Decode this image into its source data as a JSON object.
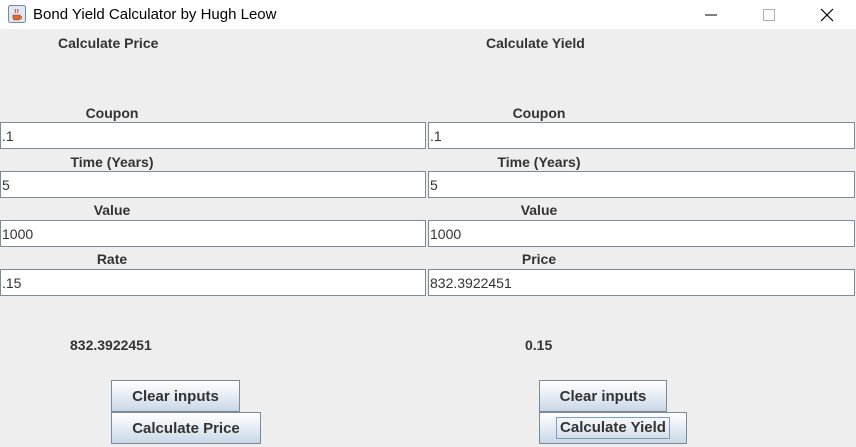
{
  "window": {
    "title": "Bond Yield Calculator by Hugh Leow"
  },
  "price_panel": {
    "title": "Calculate Price",
    "coupon_label": "Coupon",
    "coupon_value": ".1",
    "time_label": "Time (Years)",
    "time_value": "5",
    "value_label": "Value",
    "value_value": "1000",
    "rate_label": "Rate",
    "rate_value": ".15",
    "result": "832.3922451",
    "clear_label": "Clear inputs",
    "calculate_label": "Calculate Price"
  },
  "yield_panel": {
    "title": "Calculate Yield",
    "coupon_label": "Coupon",
    "coupon_value": ".1",
    "time_label": "Time (Years)",
    "time_value": "5",
    "value_label": "Value",
    "value_value": "1000",
    "price_label": "Price",
    "price_value": "832.3922451",
    "result": "0.15",
    "clear_label": "Clear inputs",
    "calculate_label": "Calculate Yield"
  },
  "colors": {
    "background": "#eeeeee",
    "button_border": "#7a8a99",
    "label_text": "#333333"
  }
}
